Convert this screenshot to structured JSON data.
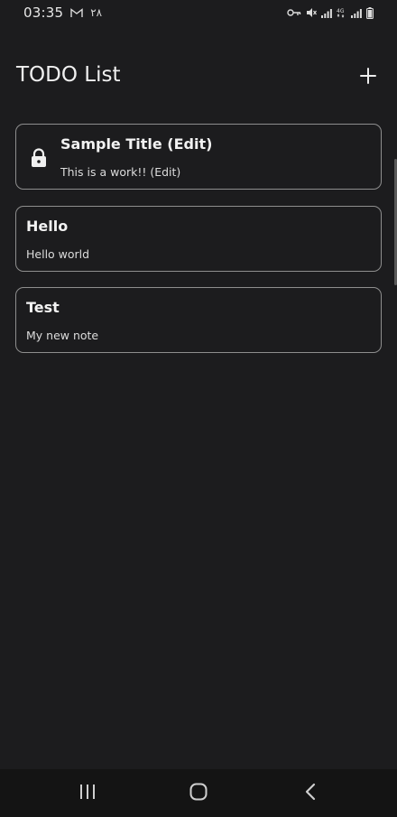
{
  "status_bar": {
    "time": "03:35",
    "date": "٢٨",
    "icons": [
      "gmail-icon",
      "vpn-key-icon",
      "mute-icon",
      "signal-icon",
      "4g-icon",
      "signal-icon",
      "battery-icon"
    ]
  },
  "header": {
    "title": "TODO List",
    "add_icon": "plus-icon"
  },
  "notes": [
    {
      "title": "Sample Title (Edit)",
      "body": "This is a work!! (Edit)",
      "locked": true
    },
    {
      "title": "Hello",
      "body": "Hello world",
      "locked": false
    },
    {
      "title": "Test",
      "body": "My new note",
      "locked": false
    }
  ],
  "navigation": {
    "recents_icon": "recents-icon",
    "home_icon": "home-icon",
    "back_icon": "back-icon"
  },
  "colors": {
    "background": "#1c1c1e",
    "card_border": "#8e8e8e",
    "text_primary": "#f2f2f2",
    "nav_bar": "#141414"
  }
}
